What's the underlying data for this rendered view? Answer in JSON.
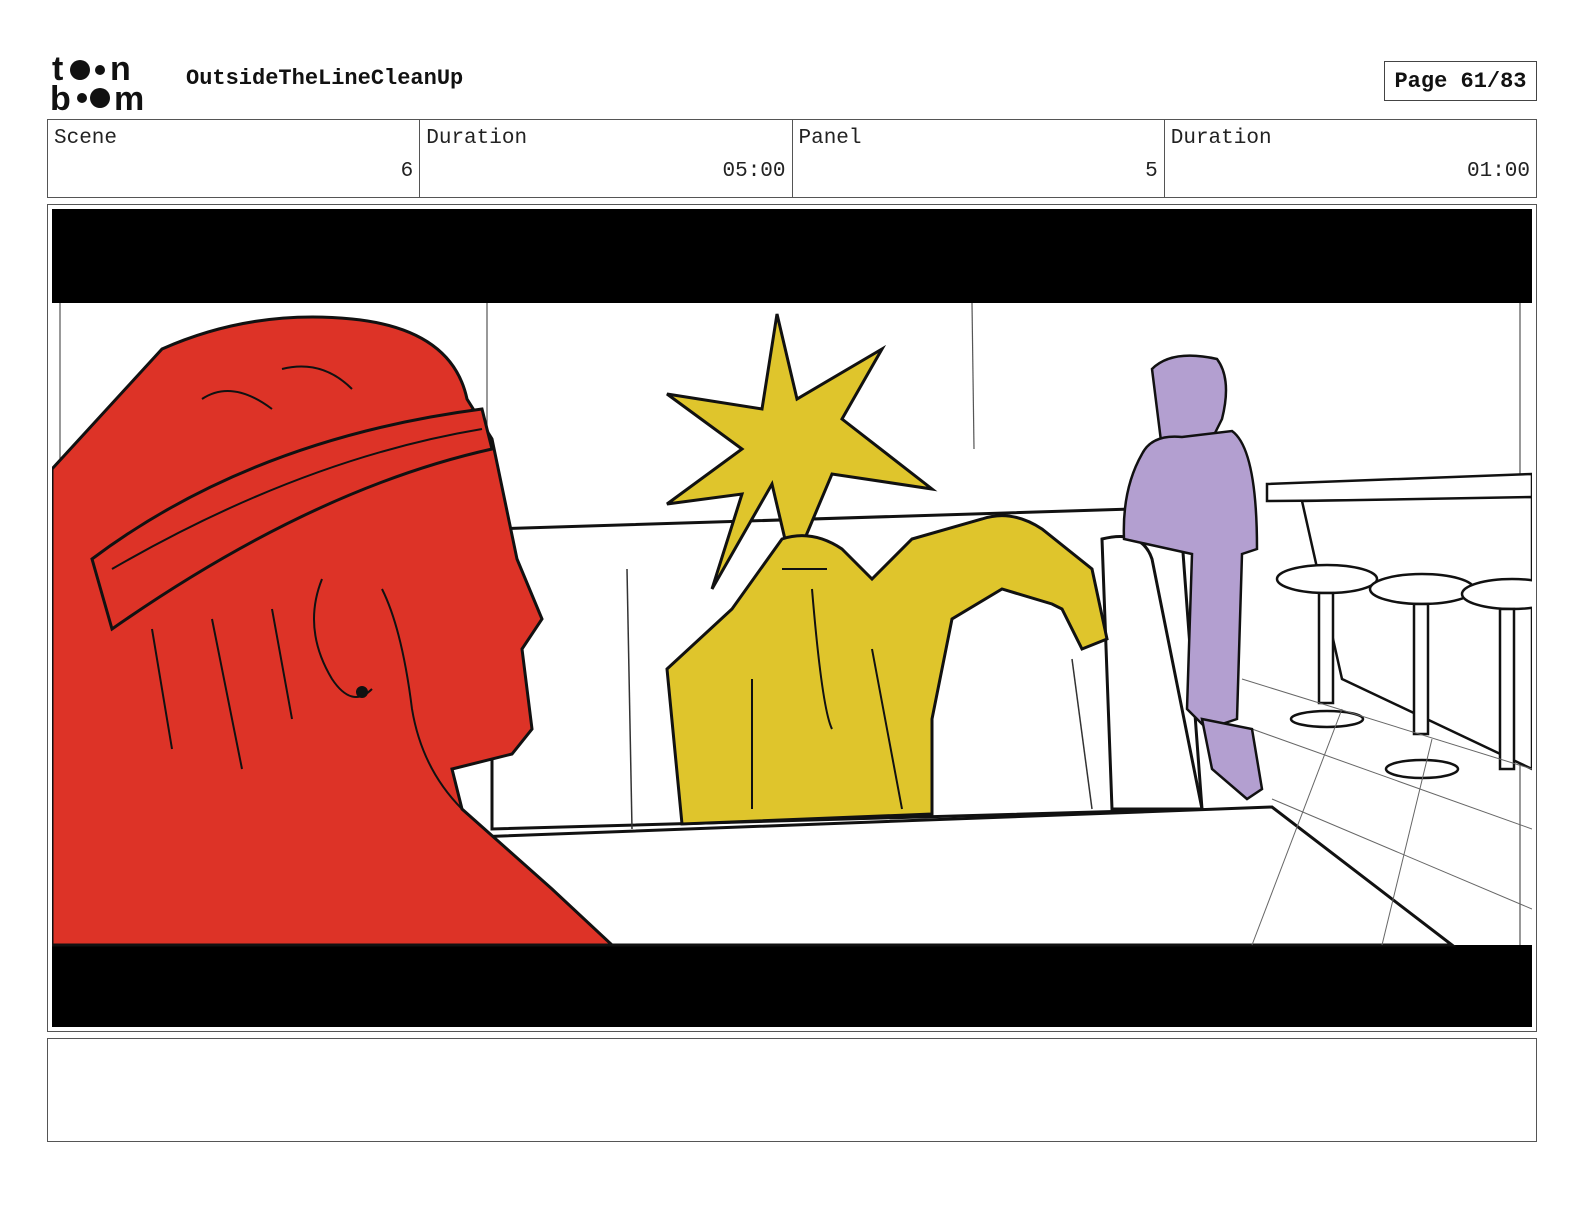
{
  "header": {
    "logo_alt": "toon boom",
    "project_title": "OutsideTheLineCleanUp",
    "page_label": "Page 61/83"
  },
  "info": {
    "scene_label": "Scene",
    "scene_value": "6",
    "scene_duration_label": "Duration",
    "scene_duration_value": "05:00",
    "panel_label": "Panel",
    "panel_value": "5",
    "panel_duration_label": "Duration",
    "panel_duration_value": "01:00"
  },
  "frame": {
    "description_colors": {
      "red": "#dd3327",
      "yellow": "#dfc52c",
      "purple": "#b39fd0",
      "letterbox": "#000000"
    }
  },
  "notes": {
    "text": ""
  }
}
